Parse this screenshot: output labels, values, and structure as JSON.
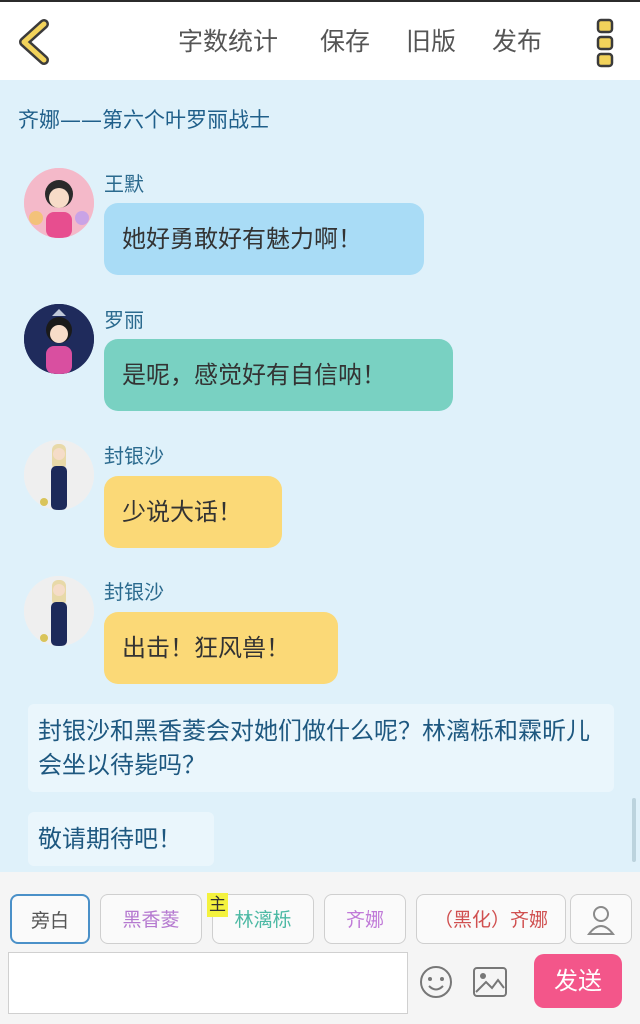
{
  "header": {
    "word_count": "字数统计",
    "save": "保存",
    "old_version": "旧版",
    "publish": "发布"
  },
  "chat_title": "齐娜——第六个叶罗丽战士",
  "messages": [
    {
      "name": "王默",
      "text": "她好勇敢好有魅力啊！",
      "color": "#a9dcf6"
    },
    {
      "name": "罗丽",
      "text": "是呢，感觉好有自信呐！",
      "color": "#79d1c2"
    },
    {
      "name": "封银沙",
      "text": "少说大话！",
      "color": "#fbd977"
    },
    {
      "name": "封银沙",
      "text": "出击！狂风兽！",
      "color": "#fbd977"
    }
  ],
  "narrations": [
    "封银沙和黑香菱会对她们做什么呢？林漓栎和霖昕儿会坐以待毙吗？",
    "敬请期待吧！"
  ],
  "characters": [
    {
      "label": "旁白",
      "color": "#555555"
    },
    {
      "label": "黑香菱",
      "color": "#b57ad0"
    },
    {
      "label": "林漓栎",
      "color": "#4cb9a4",
      "badge": "主"
    },
    {
      "label": "齐娜",
      "color": "#c07ad8"
    },
    {
      "label": "（黑化）齐娜",
      "color": "#d05050"
    }
  ],
  "input": {
    "placeholder": ""
  },
  "send_label": "发送"
}
